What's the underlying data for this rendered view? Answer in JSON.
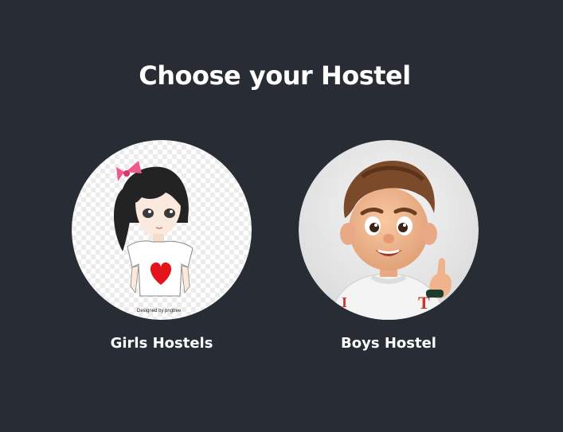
{
  "page": {
    "title": "Choose your Hostel"
  },
  "options": [
    {
      "label": "Girls Hostels",
      "watermark": "Designed by pngtree"
    },
    {
      "label": "Boys Hostel"
    }
  ],
  "colors": {
    "background": "#282c34",
    "text": "#ffffff"
  }
}
